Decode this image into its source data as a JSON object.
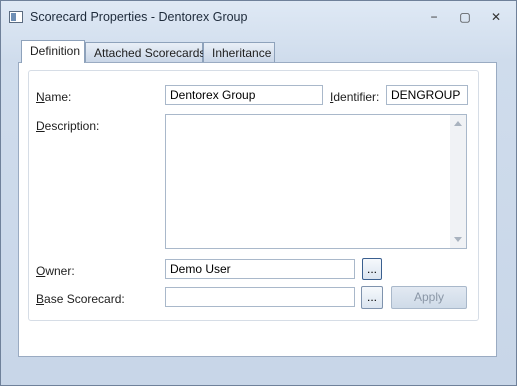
{
  "window": {
    "title": "Scorecard Properties - Dentorex Group",
    "controls": {
      "minimize": "−",
      "maximize": "▢",
      "close": "✕"
    }
  },
  "tabs": [
    {
      "label": "Definition",
      "active": true
    },
    {
      "label": "Attached Scorecards",
      "active": false
    },
    {
      "label": "Inheritance",
      "active": false
    }
  ],
  "form": {
    "name_label_mnemonic": "N",
    "name_label_rest": "ame:",
    "name_value": "Dentorex Group",
    "identifier_label_mnemonic": "I",
    "identifier_label_rest": "dentifier:",
    "identifier_value": "DENGROUP",
    "description_label_mnemonic": "D",
    "description_label_rest": "escription:",
    "description_value": "",
    "owner_label_mnemonic": "O",
    "owner_label_rest": "wner:",
    "owner_value": "Demo User",
    "owner_browse_label": "...",
    "base_label_mnemonic": "B",
    "base_label_rest": "ase Scorecard:",
    "base_value": "",
    "base_browse_label": "...",
    "apply_label": "Apply"
  }
}
